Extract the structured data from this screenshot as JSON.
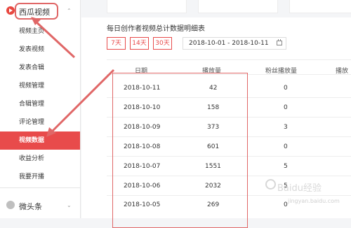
{
  "sidebar": {
    "section_title": "西瓜视频",
    "items": [
      {
        "label": "视频主页"
      },
      {
        "label": "发表视频"
      },
      {
        "label": "发表合辑"
      },
      {
        "label": "视频管理"
      },
      {
        "label": "合辑管理"
      },
      {
        "label": "评论管理"
      },
      {
        "label": "视频数据",
        "active": true
      },
      {
        "label": "收益分析"
      },
      {
        "label": "我要开播"
      }
    ],
    "footer_section": "微头条",
    "chevron": "⌃",
    "chevron_down": "⌄"
  },
  "main": {
    "title": "每日创作者视频总计数据明细表",
    "range_buttons": [
      "7天",
      "14天",
      "30天"
    ],
    "date_range": "2018-10-01  -  2018-10-11",
    "columns": [
      "日期",
      "播放量",
      "粉丝播放量",
      "播放"
    ],
    "rows": [
      {
        "date": "2018-10-11",
        "plays": "42",
        "fan_plays": "0"
      },
      {
        "date": "2018-10-10",
        "plays": "158",
        "fan_plays": "0"
      },
      {
        "date": "2018-10-09",
        "plays": "373",
        "fan_plays": "3"
      },
      {
        "date": "2018-10-08",
        "plays": "601",
        "fan_plays": "0"
      },
      {
        "date": "2018-10-07",
        "plays": "1551",
        "fan_plays": "5"
      },
      {
        "date": "2018-10-06",
        "plays": "2032",
        "fan_plays": "5"
      },
      {
        "date": "2018-10-05",
        "plays": "269",
        "fan_plays": "0"
      }
    ]
  },
  "watermark": {
    "text": "Baidu经验",
    "sub": "jingyan.baidu.com"
  },
  "colors": {
    "accent": "#e84b4b",
    "annotation": "#e06767"
  }
}
